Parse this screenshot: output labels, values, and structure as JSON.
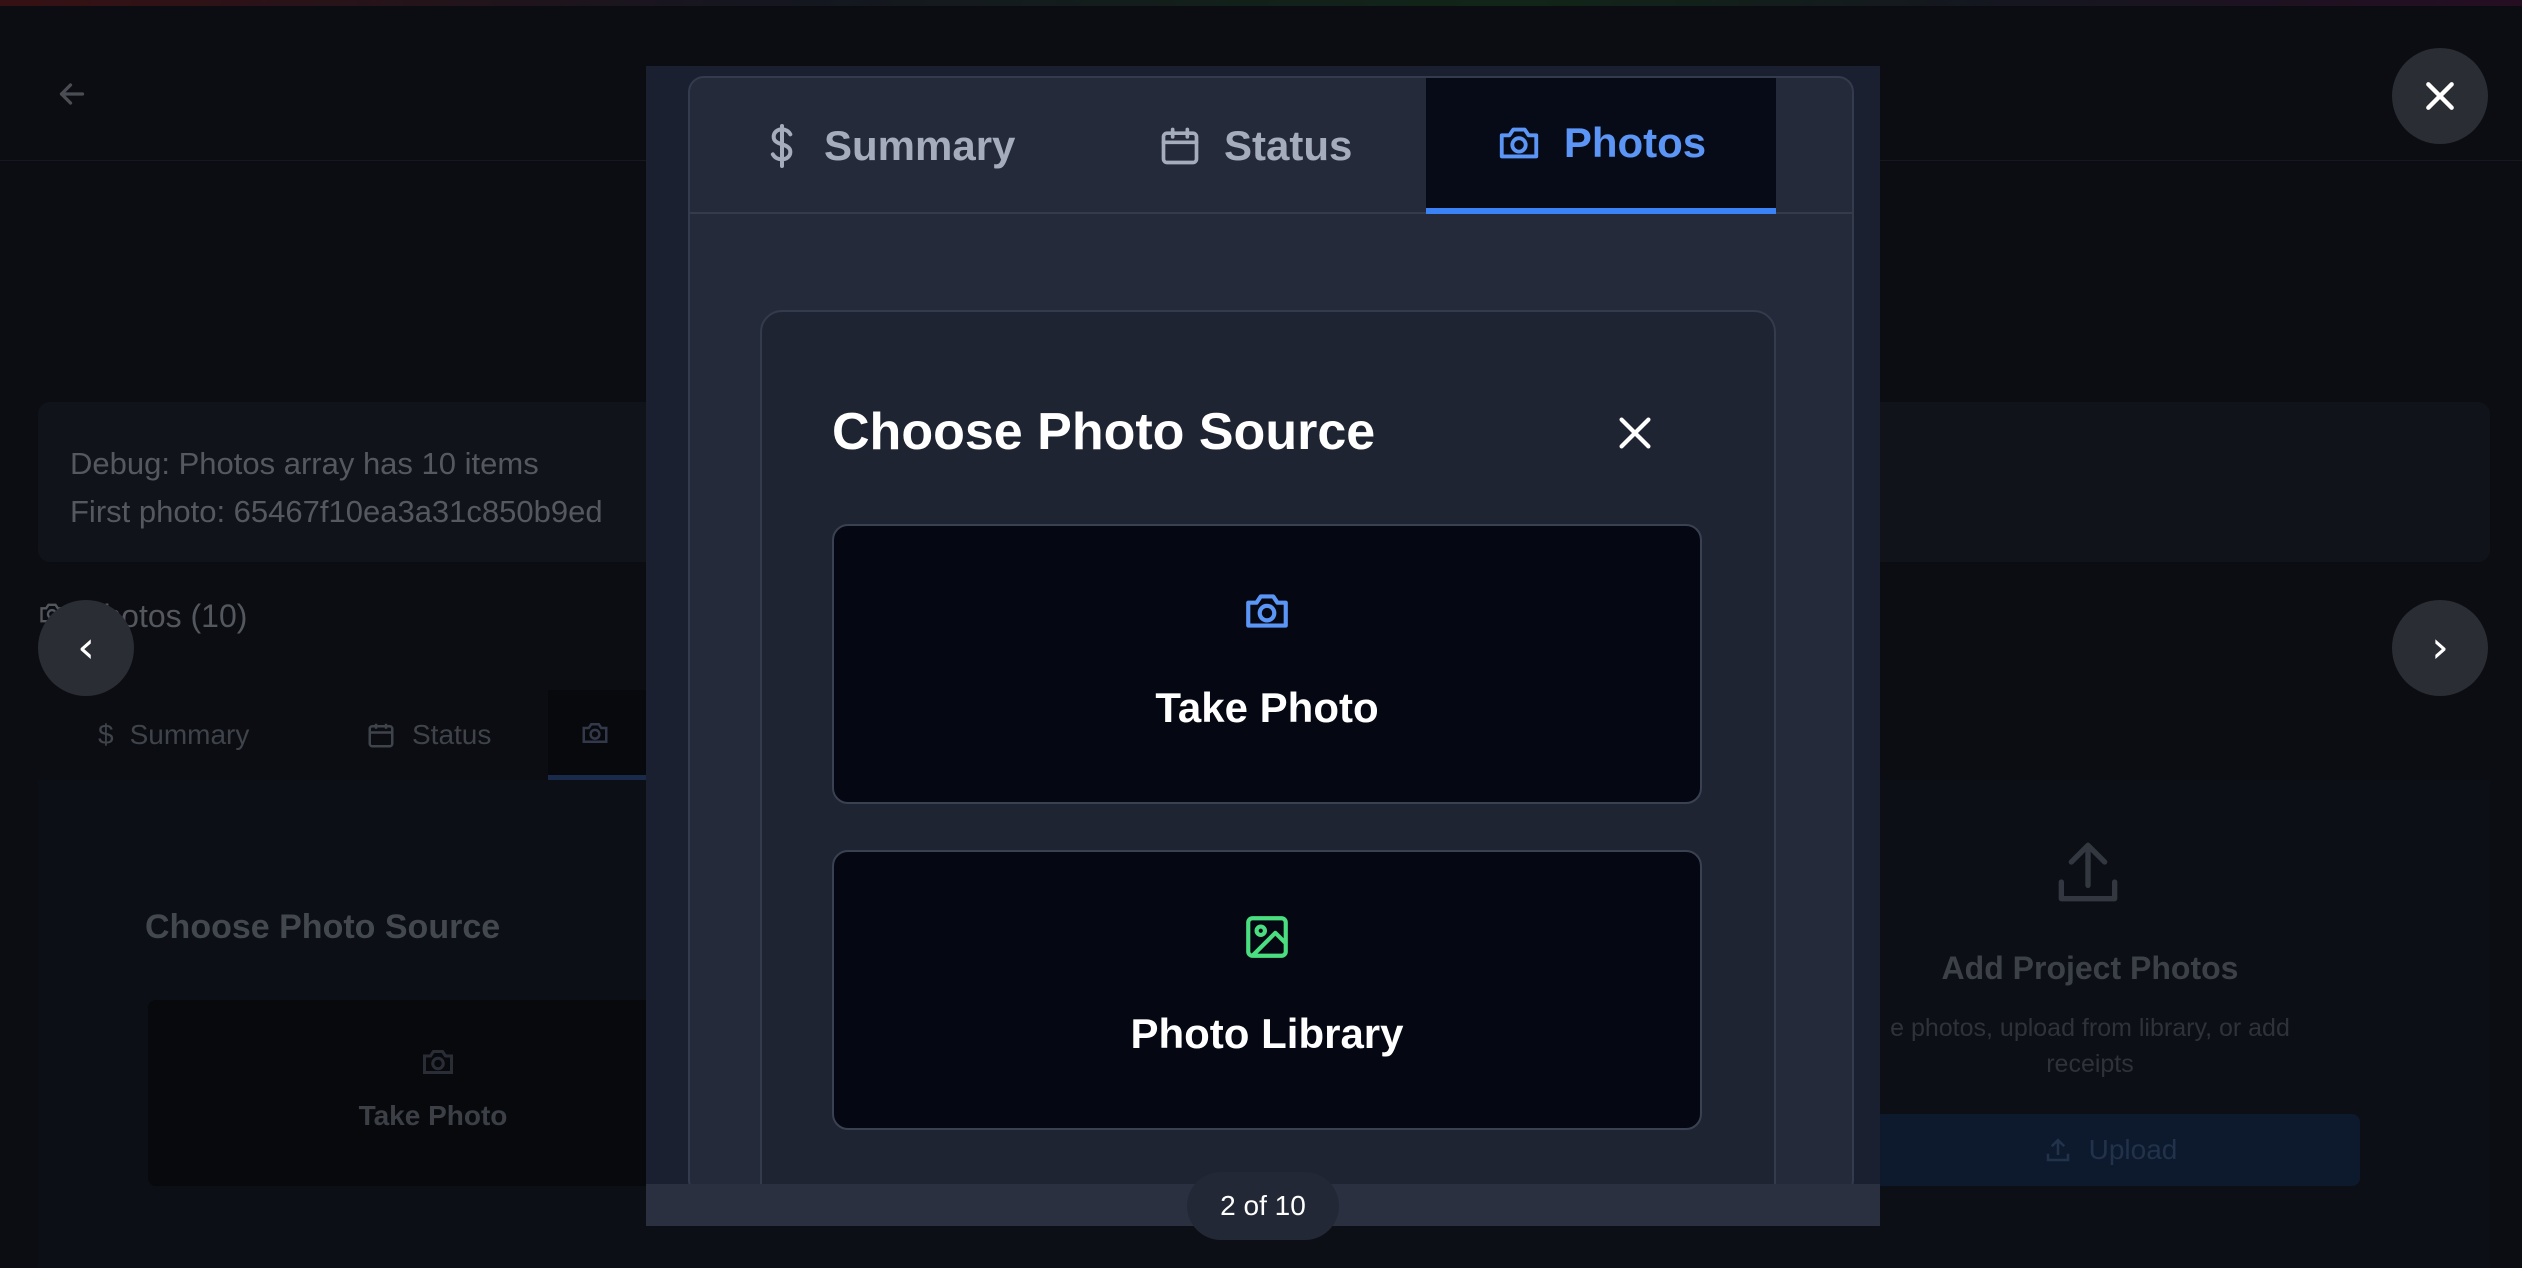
{
  "background": {
    "debug_line1": "Debug: Photos array has 10 items",
    "debug_line2": "First photo: 65467f10ea3a31c850b9ed",
    "photos_header": "Photos (10)",
    "tabs": [
      "Summary",
      "Status"
    ],
    "choose_title": "Choose Photo Source",
    "take_photo": "Take Photo",
    "add_title": "Add Project Photos",
    "add_subtitle": "e photos, upload from library, or add receipts",
    "upload_label": "Upload"
  },
  "viewer": {
    "tabs": {
      "summary": "Summary",
      "status": "Status",
      "photos": "Photos",
      "active": "Photos"
    },
    "dialog": {
      "title": "Choose Photo Source",
      "options": [
        {
          "label": "Take Photo",
          "icon": "camera-icon",
          "color": "#5b95f5"
        },
        {
          "label": "Photo Library",
          "icon": "image-icon",
          "color": "#4ade80"
        }
      ]
    },
    "counter": "2 of 10"
  },
  "controls": {
    "prev": "‹",
    "next": "›"
  },
  "colors": {
    "accent": "#3b82f6",
    "library_icon": "#4ade80",
    "active_tab_bg": "#070b17"
  }
}
